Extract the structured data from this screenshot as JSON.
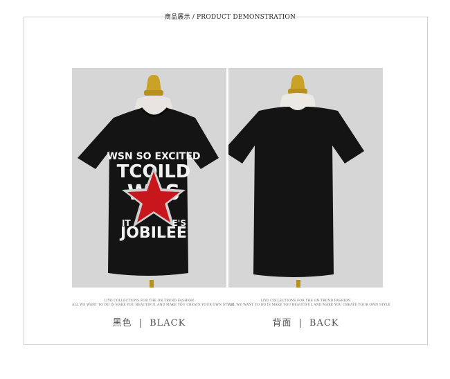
{
  "header": {
    "title_cn": "商品展示",
    "separator": "/",
    "title_en": "PRODUCT DEMONSTRATION"
  },
  "front": {
    "print_lines": [
      "WSN SO EXCITED",
      "TCOILD",
      "WAS",
      "IT",
      "E'S",
      "JOBILEE"
    ],
    "fine_line1": "LIYD COLLECTIONS FOR THE ON TREND FASHION",
    "fine_line2": "ALL WE WANT TO DO IS MAKE YOU BEAUTIFUL AND MAKE YOU CREATE YOUR OWN STYLE",
    "caption_cn": "黑色",
    "caption_sep": "|",
    "caption_en": "BLACK"
  },
  "back": {
    "fine_line1": "LIYD COLLECTIONS FOR THE ON TREND FASHION",
    "fine_line2": "ALL WE WANT TO DO IS MAKE YOU BEAUTIFUL AND MAKE YOU CREATE YOUR OWN STYLE",
    "caption_cn": "背面",
    "caption_sep": "|",
    "caption_en": "BACK"
  },
  "colors": {
    "background": "#ffffff",
    "photo_bg": "#d9d9d9",
    "shirt": "#111111",
    "star": "#c8161d",
    "gold": "#c9a227"
  }
}
